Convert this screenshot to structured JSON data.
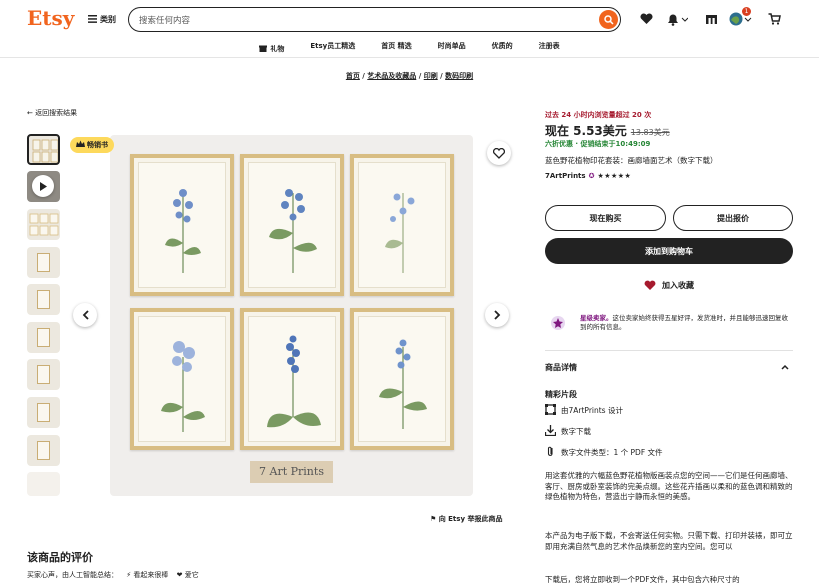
{
  "header": {
    "logo": "Etsy",
    "category_label": "类别",
    "search_placeholder": "搜索任何内容",
    "cart_badge": "1"
  },
  "nav": [
    "礼物",
    "Etsy员工精选",
    "首页 精选",
    "时尚单品",
    "优质的",
    "注册表"
  ],
  "breadcrumb": [
    "首页",
    "艺术品及收藏品",
    "印刷",
    "数码印刷"
  ],
  "back_label": "返回搜索结果",
  "badge": "畅销书",
  "watermark": "7 Art Prints",
  "report_label": "向 Etsy 举报此商品",
  "reviews_title": "该商品的评价",
  "reviews_sub": "买家心声，由人工智能总结：",
  "reviews_tags": [
    "⚡ 看起来很棒",
    "❤ 爱它"
  ],
  "product": {
    "popularity": "过去 24 小时内浏览量超过 20 次",
    "price_now": "现在 5.53美元",
    "price_old": "13.83美元",
    "sale": "六折优惠 · 促销结束于10:49:09",
    "title": "蓝色野花植物印花套装：画廊墙面艺术（数字下载）",
    "shop": "7ArtPrints",
    "stars": "★★★★★",
    "buy_now": "现在购买",
    "make_offer": "提出报价",
    "add_cart": "添加到购物车",
    "favorite": "加入收藏",
    "star_seller_title": "星级卖家。",
    "star_seller_text": "这位卖家始终获得五星好评，发货准时，并且能够迅速回复收到的所有信息。",
    "details_title": "商品详情",
    "highlights": "精彩片段",
    "designed_by": "由7ArtPrints 设计",
    "digital": "数字下载",
    "file_type": "数字文件类型：1 个 PDF 文件",
    "desc1": "用这套优雅的六幅蓝色野花植物版画装点您的空间——它们是任何画廊墙、客厅、厨房或卧室装饰的完美点缀。这些花卉插画以柔和的蓝色调和精致的绿色植物为特色，营造出宁静而永恒的美感。",
    "desc2": "本产品为电子版下载，不会寄送任何实物。只需下载、打印并装裱，即可立即用充满自然气息的艺术作品焕新您的室内空间。您可以",
    "desc3": "下载后，您将立即收到一个PDF文件，其中包含六种尺寸的"
  },
  "colors": {
    "accent": "#f1641e",
    "dark": "#222222",
    "sale": "#258635",
    "red": "#a61a2e",
    "star_seller": "#7f187f"
  }
}
